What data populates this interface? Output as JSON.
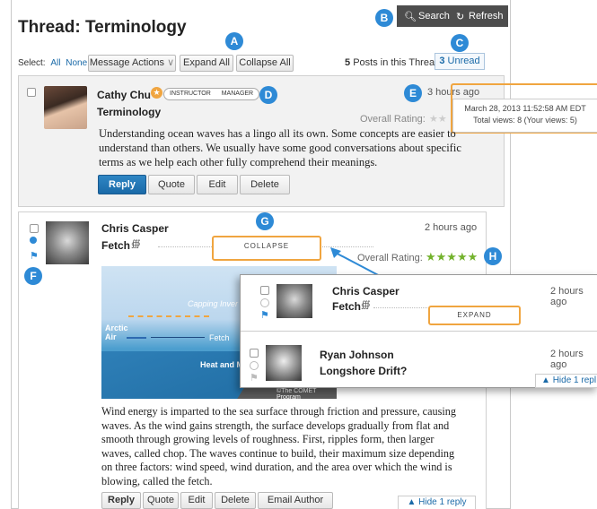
{
  "header": {
    "title": "Thread: Terminology",
    "search_label": "Search",
    "refresh_label": "Refresh"
  },
  "toolbar": {
    "select_label": "Select:",
    "select_all": "All",
    "select_none": "None",
    "message_actions": "Message Actions",
    "expand_all": "Expand All",
    "collapse_all": "Collapse All",
    "posts_count": "5",
    "posts_label": "Posts in this Thread",
    "unread_count": "3",
    "unread_label": "Unread"
  },
  "badges": {
    "a": "A",
    "b": "B",
    "c": "C",
    "d": "D",
    "e": "E",
    "f": "F",
    "g": "G",
    "h": "H"
  },
  "post1": {
    "author": "Cathy Chu",
    "role_instructor": "INSTRUCTOR",
    "role_manager": "MANAGER",
    "subject": "Terminology",
    "time": "3 hours ago",
    "tooltip_date": "March 28, 2013 11:52:58 AM EDT",
    "tooltip_views": "Total views: 8  (Your views: 5)",
    "rating_label": "Overall Rating:",
    "body": "Understanding ocean waves has a lingo all its own. Some concepts are easier to understand than others. We usually have some good conversations about specific terms as we help each other fully comprehend their meanings.",
    "reply": "Reply",
    "quote": "Quote",
    "edit": "Edit",
    "delete": "Delete"
  },
  "post2": {
    "author": "Chris Casper",
    "subject": "Fetch",
    "time": "2 hours ago",
    "collapse": "COLLAPSE",
    "rating_label": "Overall Rating:",
    "rating": 5,
    "diagram_capping": "Capping Inver",
    "diagram_arctic": "Arctic",
    "diagram_air": "Air",
    "diagram_fetch": "Fetch",
    "diagram_heat": "Heat and M",
    "diagram_credit": "©The COMET Program",
    "body": "Wind energy is imparted to the sea surface through friction and pressure, causing waves. As the wind gains strength, the surface develops gradually from flat and smooth through growing levels of roughness. First, ripples form, then larger waves, called chop. The waves continue to build, their maximum size depending on three factors: wind speed, wind duration, and the area over which the wind is blowing, called the fetch.",
    "reply": "Reply",
    "quote": "Quote",
    "edit": "Edit",
    "delete": "Delete",
    "email_author": "Email Author",
    "hide_reply": "Hide 1 reply"
  },
  "overlay": {
    "post_a_author": "Chris Casper",
    "post_a_subject": "Fetch",
    "post_a_time": "2 hours ago",
    "expand": "EXPAND",
    "post_b_author": "Ryan Johnson",
    "post_b_subject": "Longshore Drift?",
    "post_b_time": "2 hours ago",
    "hide_reply": "Hide 1 repl"
  },
  "colors": {
    "badge": "#2e8ad6",
    "accent": "#1a6aa8",
    "highlight": "#f0a540",
    "star": "#73b22c"
  }
}
